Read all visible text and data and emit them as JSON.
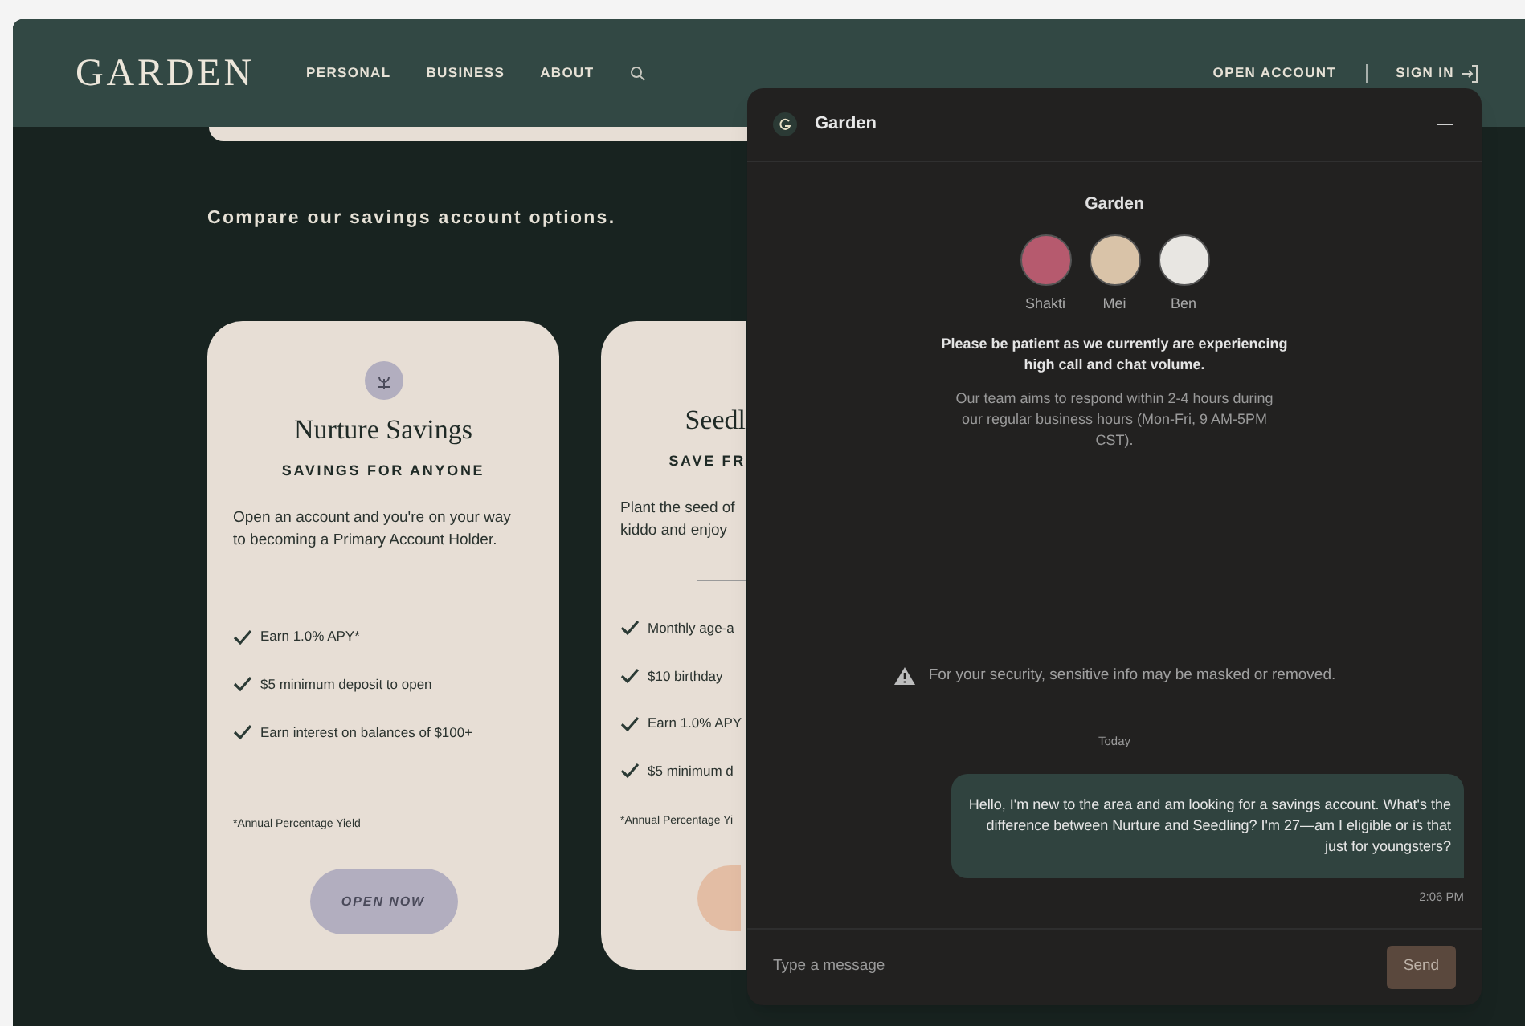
{
  "header": {
    "logo": "GARDEN",
    "nav": [
      {
        "label": "PERSONAL"
      },
      {
        "label": "BUSINESS"
      },
      {
        "label": "ABOUT"
      }
    ],
    "open_account": "OPEN ACCOUNT",
    "sign_in": "SIGN IN"
  },
  "compare_heading": "Compare our savings account options.",
  "cards": [
    {
      "title": "Nurture Savings",
      "subtitle": "SAVINGS FOR ANYONE",
      "description": [
        "Open an account and you're on your way",
        "to becoming a Primary Account Holder."
      ],
      "features": [
        "Earn 1.0% APY*",
        "$5 minimum deposit to open",
        "Earn interest on balances of $100+"
      ],
      "footnote": "*Annual Percentage Yield",
      "button": "OPEN NOW",
      "kind": "full"
    },
    {
      "title": "Seedl",
      "subtitle": "SAVE FR",
      "description": [
        "Plant the seed of",
        "kiddo and enjoy"
      ],
      "features": [
        "Monthly age-a",
        "$10 birthday",
        "Earn 1.0% APY",
        "$5 minimum d"
      ],
      "footnote": "*Annual Percentage Yi",
      "kind": "clipped"
    }
  ],
  "chat": {
    "title": "Garden",
    "team_name": "Garden",
    "agents": [
      {
        "name": "Shakti"
      },
      {
        "name": "Mei"
      },
      {
        "name": "Ben"
      }
    ],
    "notice": "Please be patient as we currently are experiencing high call and chat volume.",
    "hours": "Our team aims to respond within 2-4 hours during our regular business hours (Mon-Fri, 9 AM-5PM CST).",
    "security": "For your security, sensitive info may be masked or removed.",
    "day": "Today",
    "messages": [
      {
        "text": "Hello, I'm new to the area and am looking for a savings account. What's the difference between Nurture and Seedling? I'm 27—am I eligible or is that just for youngsters?",
        "time": "2:06 PM"
      }
    ],
    "input": {
      "placeholder": "Type a message"
    },
    "send": "Send"
  }
}
